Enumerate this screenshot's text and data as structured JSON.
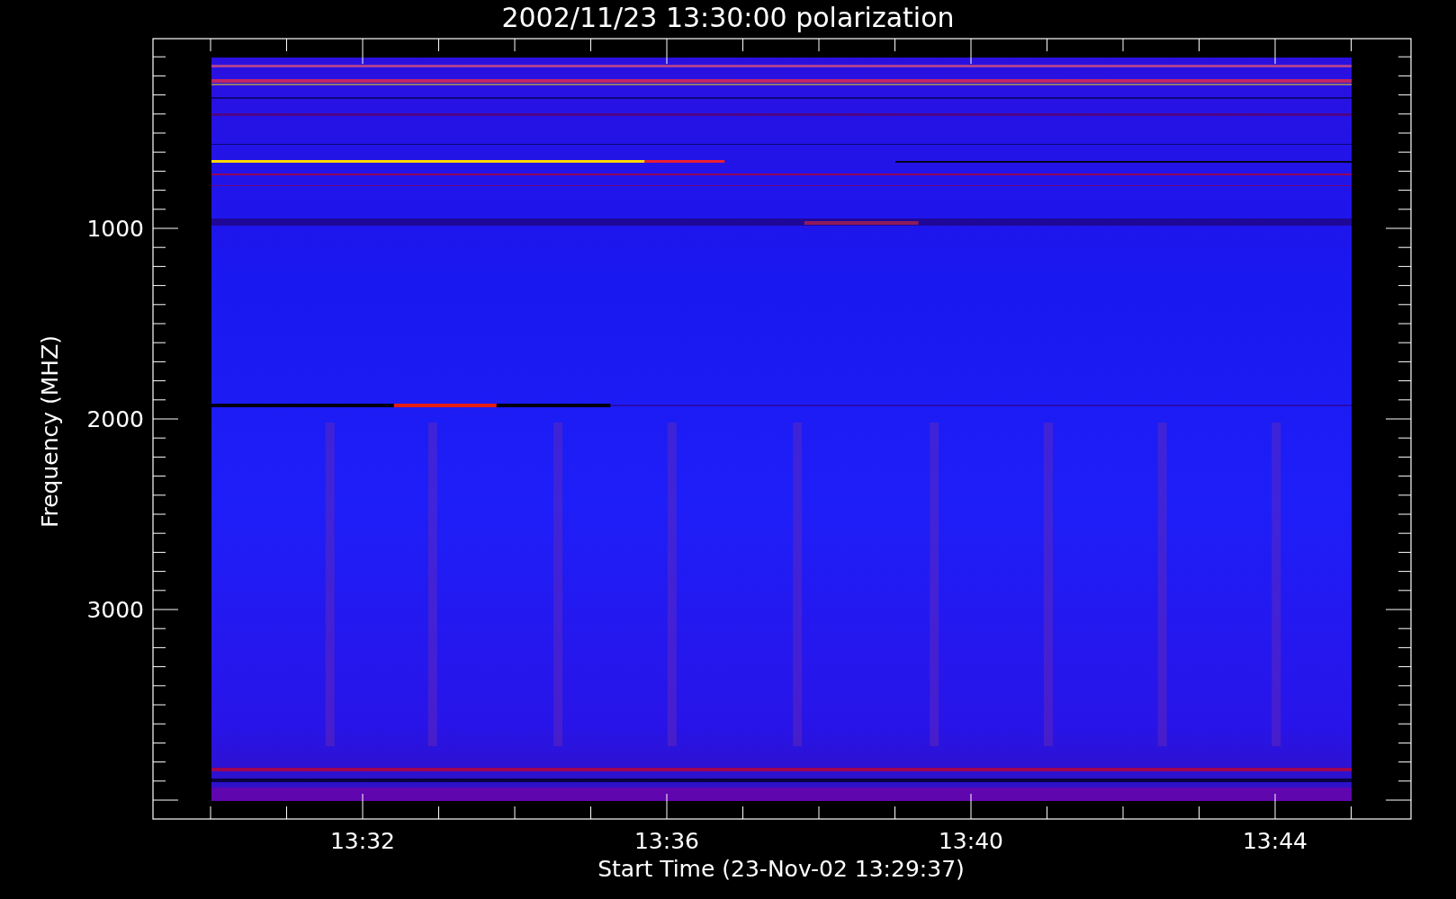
{
  "plot": {
    "title": "2002/11/23 13:30:00 polarization",
    "xlabel": "Start Time (23-Nov-02 13:29:37)",
    "ylabel": "Frequency (MHZ)",
    "y_tick_labels": [
      "1000",
      "2000",
      "3000"
    ],
    "x_tick_labels": [
      "13:32",
      "13:36",
      "13:40",
      "13:44"
    ]
  }
}
